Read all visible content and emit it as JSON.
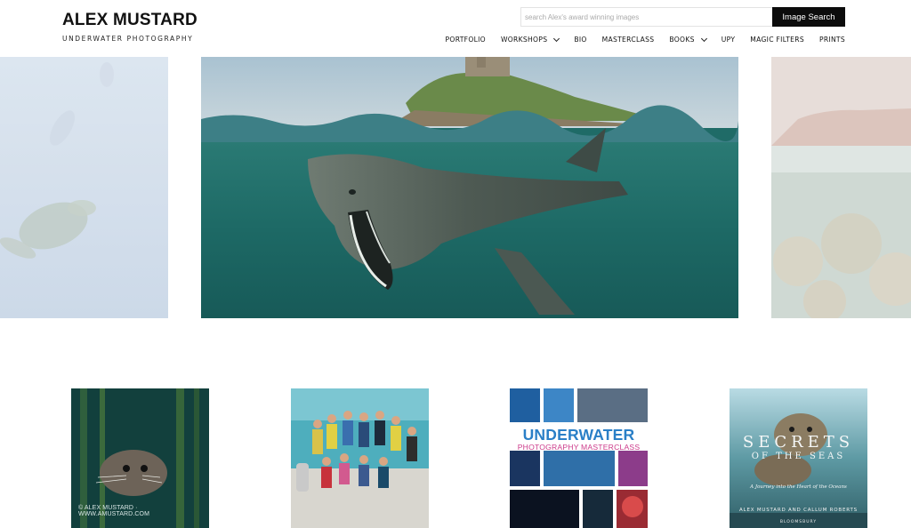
{
  "brand": {
    "name": "ALEX MUSTARD",
    "tagline": "UNDERWATER PHOTOGRAPHY"
  },
  "search": {
    "placeholder": "search Alex's award winning images",
    "button_label": "Image Search"
  },
  "nav": {
    "items": [
      {
        "label": "PORTFOLIO",
        "has_dropdown": false
      },
      {
        "label": "WORKSHOPS",
        "has_dropdown": true
      },
      {
        "label": "BIO",
        "has_dropdown": false
      },
      {
        "label": "MASTERCLASS",
        "has_dropdown": false
      },
      {
        "label": "BOOKS",
        "has_dropdown": true
      },
      {
        "label": "UPY",
        "has_dropdown": false
      },
      {
        "label": "MAGIC FILTERS",
        "has_dropdown": false
      },
      {
        "label": "PRINTS",
        "has_dropdown": false
      }
    ]
  },
  "hero": {
    "slides": [
      {
        "name": "turtle-slide",
        "active": false
      },
      {
        "name": "basking-shark-slide",
        "active": true
      },
      {
        "name": "coral-reef-slide",
        "active": false
      }
    ]
  },
  "thumbnails": {
    "seal_watermark": "© ALEX MUSTARD · WWW.AMUSTARD.COM",
    "masterclass_title_1": "UNDERWATER",
    "masterclass_title_2": "PHOTOGRAPHY MASTERCLASS",
    "secrets_title": "SECRETS",
    "secrets_subtitle": "OF THE SEAS",
    "secrets_tagline": "A Journey into the Heart of the Oceans",
    "secrets_authors": "ALEX MUSTARD AND CALLUM ROBERTS",
    "secrets_publisher": "BLOOMSBURY"
  },
  "colors": {
    "search_button_bg": "#0c0c0c",
    "masterclass_blue": "#2a7fc7",
    "masterclass_pink": "#cc3a8a",
    "sea_green": "#1f6b67"
  }
}
